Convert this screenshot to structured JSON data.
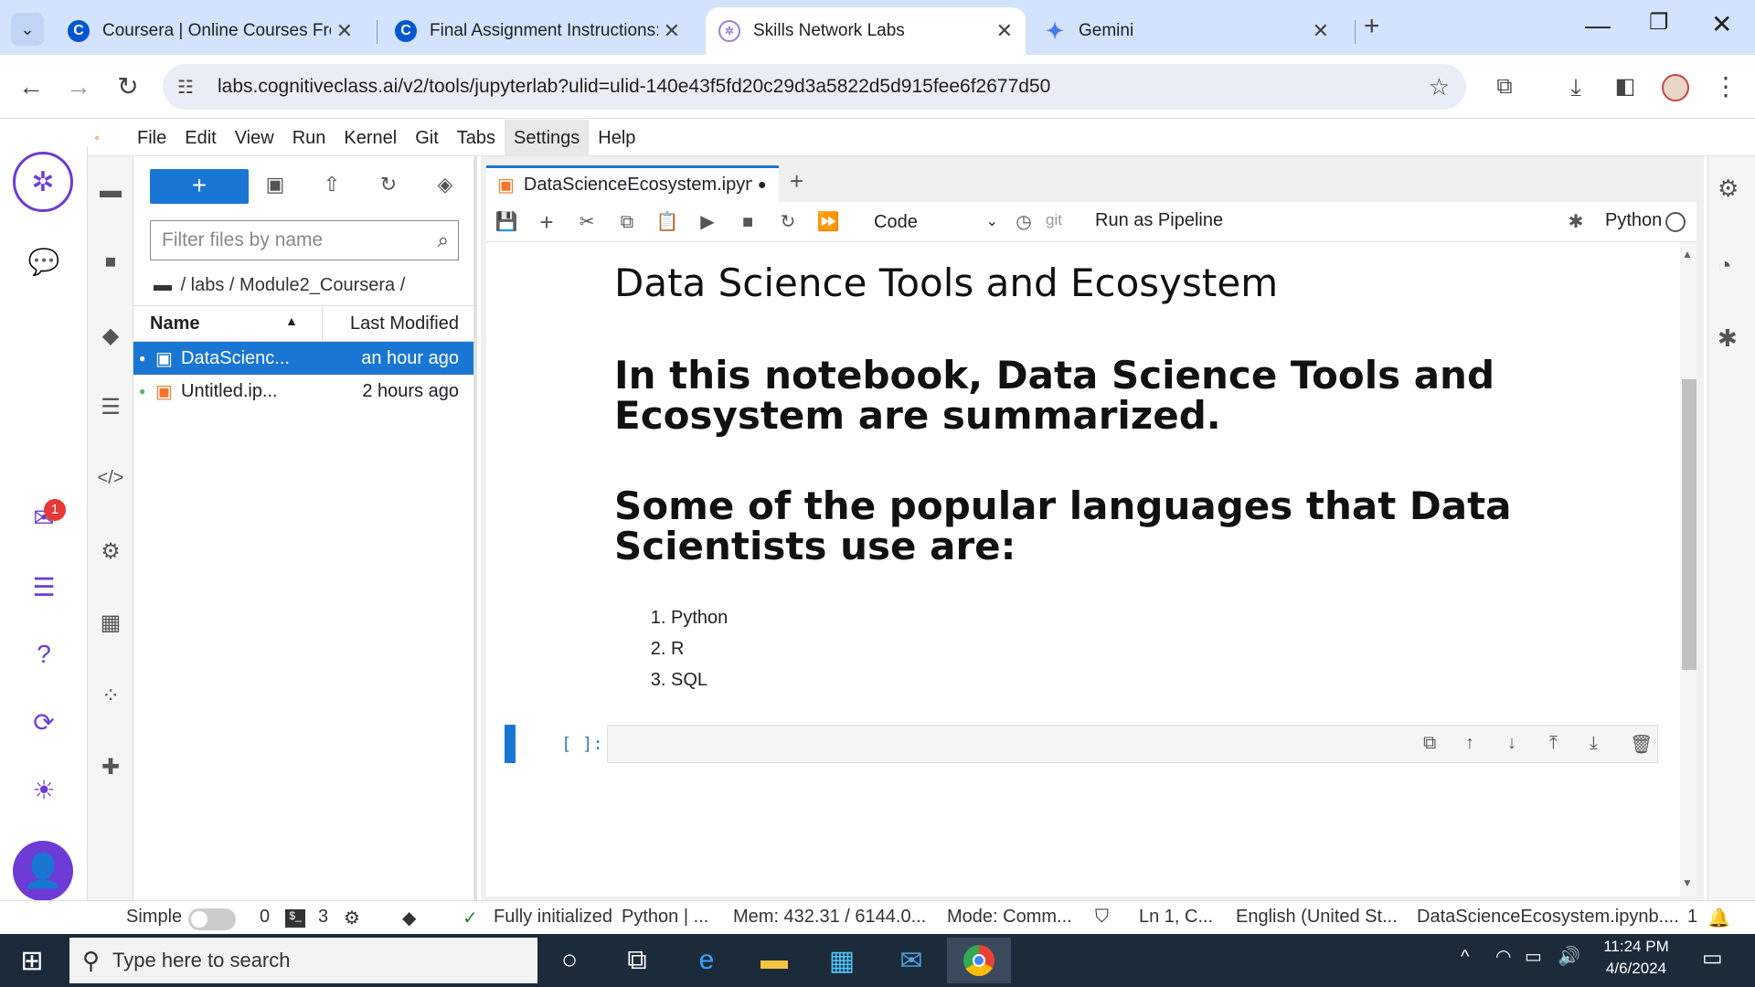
{
  "browser": {
    "tabs": [
      {
        "title": "Coursera | Online Courses From",
        "icon": "coursera-icon"
      },
      {
        "title": "Final Assignment Instructions: C",
        "icon": "coursera-icon"
      },
      {
        "title": "Skills Network Labs",
        "icon": "skills-network-icon",
        "active": true
      },
      {
        "title": "Gemini",
        "icon": "gemini-icon"
      }
    ],
    "url": "labs.cognitiveclass.ai/v2/tools/jupyterlab?ulid=ulid-140e43f5fd20c29d3a5822d5d915fee6f2677d50"
  },
  "menu": [
    "File",
    "Edit",
    "View",
    "Run",
    "Kernel",
    "Git",
    "Tabs",
    "Settings",
    "Help"
  ],
  "ibm_sidebar": {
    "notification_count": "1"
  },
  "filebrowser": {
    "new_label": "+",
    "filter_placeholder": "Filter files by name",
    "breadcrumb": "/ labs / Module2_Coursera /",
    "columns": {
      "name": "Name",
      "modified": "Last Modified"
    },
    "files": [
      {
        "name": "DataScienc...",
        "modified": "an hour ago",
        "selected": true
      },
      {
        "name": "Untitled.ip...",
        "modified": "2 hours ago",
        "selected": false
      }
    ]
  },
  "notebook": {
    "tab_title": "DataScienceEcosystem.ipynb",
    "cell_type": "Code",
    "git_label": "git",
    "pipeline_label": "Run as Pipeline",
    "kernel": "Python",
    "h1": "Data Science Tools and Ecosystem",
    "h2a": "In this notebook, Data Science Tools and Ecosystem are summarized.",
    "h2b": "Some of the popular languages that Data Scientists use are:",
    "languages": [
      "Python",
      "R",
      "SQL"
    ],
    "prompt": "[ ]:"
  },
  "status": {
    "mode_label": "Simple",
    "terminals": "0",
    "kernels": "3",
    "init": "Fully initialized",
    "kernel": "Python | ...",
    "mem": "Mem: 432.31 / 6144.0...",
    "mode": "Mode: Comm...",
    "pos": "Ln 1, C...",
    "lang": "English (United St...",
    "file": "DataScienceEcosystem.ipynb....",
    "notif": "1"
  },
  "taskbar": {
    "search_placeholder": "Type here to search",
    "time": "11:24 PM",
    "date": "4/6/2024"
  }
}
